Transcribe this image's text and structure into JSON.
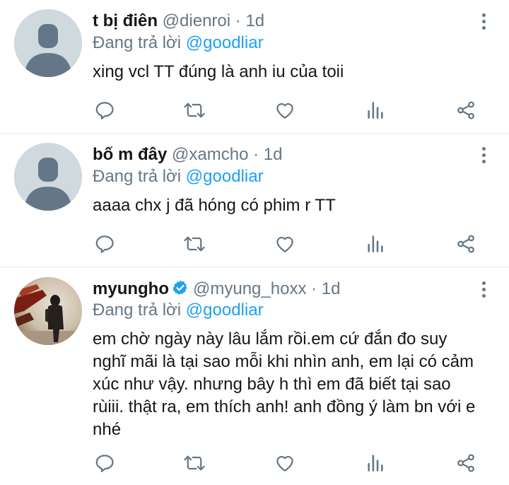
{
  "colors": {
    "accent": "#1da1f2",
    "muted": "#657786",
    "text": "#14171a",
    "divider": "#e1e8ed",
    "verified": "#1da1f2"
  },
  "icons": [
    "reply-icon",
    "retweet-icon",
    "like-icon",
    "analytics-icon",
    "share-icon",
    "more-icon",
    "verified-badge-icon"
  ],
  "tweets": [
    {
      "name": "t bị điên",
      "handle": "@dienroi",
      "separator": "·",
      "time": "1d",
      "reply_prefix": "Đang trả lời",
      "reply_to": "@goodliar",
      "text": "xing vcl TT đúng là anh iu của toii",
      "verified": false
    },
    {
      "name": "bố m đây",
      "handle": "@xamcho",
      "separator": "·",
      "time": "1d",
      "reply_prefix": "Đang trả lời",
      "reply_to": "@goodliar",
      "text": "aaaa chx j đã hóng có phim r TT",
      "verified": false
    },
    {
      "name": "myungho",
      "handle": "@myung_hoxx",
      "separator": "·",
      "time": "1d",
      "reply_prefix": "Đang trả lời",
      "reply_to": "@goodliar",
      "text": "em chờ ngày này lâu lắm rồi.em cứ đắn đo suy nghĩ mãi là tại sao mỗi khi nhìn anh, em lại có cảm xúc như vậy. nhưng bây h thì em đã biết tại sao rùiii. thật ra, em thích anh! anh đồng ý làm bn với e nhé",
      "verified": true
    }
  ]
}
